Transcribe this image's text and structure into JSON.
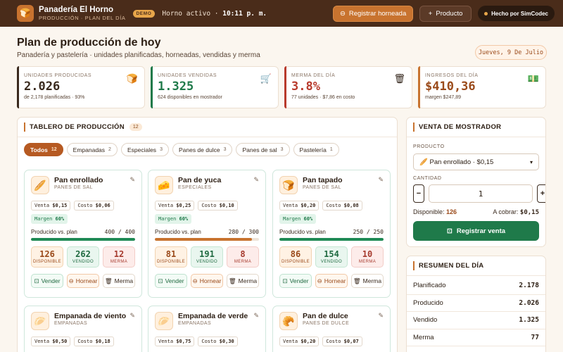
{
  "header": {
    "brand_name": "Panadería El Horno",
    "brand_sub": "PRODUCCIÓN · PLAN DEL DÍA",
    "demo_badge": "DEMO",
    "status_label": "Horno activo",
    "time": "10:11 p. m.",
    "register_batch_label": "Registrar horneada",
    "product_label": "Producto",
    "made_by": "Hecho por SimCodec"
  },
  "page": {
    "title": "Plan de producción de hoy",
    "subtitle": "Panadería y pastelería · unidades planificadas, horneadas, vendidas y merma",
    "date": "Jueves, 9 De Julio"
  },
  "kpis": [
    {
      "label": "UNIDADES PRODUCIDAS",
      "value": "2.026",
      "foot": "de 2,178 planificadas · 93%",
      "icon": "bread-icon",
      "color": "#3a2a1e"
    },
    {
      "label": "UNIDADES VENDIDAS",
      "value": "1.325",
      "foot": "624 disponibles en mostrador",
      "icon": "cart-icon",
      "color": "#1f7a4a"
    },
    {
      "label": "MERMA DEL DÍA",
      "value": "3.8%",
      "foot": "77 unidades · $7,86 en costo",
      "icon": "trash-icon",
      "color": "#b83a2c"
    },
    {
      "label": "INGRESOS DEL DÍA",
      "value": "$410,36",
      "foot": "margen $247,89",
      "icon": "money-icon",
      "color": "#9a4a1a"
    }
  ],
  "board": {
    "title": "TABLERO DE PRODUCCIÓN",
    "count": "12",
    "filters": [
      {
        "label": "Todos",
        "count": "12",
        "active": true
      },
      {
        "label": "Empanadas",
        "count": "2"
      },
      {
        "label": "Especiales",
        "count": "3"
      },
      {
        "label": "Panes de dulce",
        "count": "3"
      },
      {
        "label": "Panes de sal",
        "count": "3"
      },
      {
        "label": "Pastelería",
        "count": "1"
      }
    ],
    "labels": {
      "venta": "Venta",
      "costo": "Costo",
      "margen": "Margen",
      "progress": "Producido vs. plan",
      "disponible": "DISPONIBLE",
      "vendido": "VENDIDO",
      "merma": "MERMA",
      "sell": "Vender",
      "bake": "Hornear",
      "waste": "Merma"
    },
    "products": [
      {
        "name": "Pan enrollado",
        "category": "PANES DE SAL",
        "icon": "baguette-icon",
        "venta": "$0,15",
        "costo": "$0,06",
        "margen": "60%",
        "produced": 400,
        "plan": 400,
        "progress_label": "400 / 400",
        "disponible": "126",
        "vendido": "262",
        "merma": "12",
        "fill": "#1f8a55"
      },
      {
        "name": "Pan de yuca",
        "category": "ESPECIALES",
        "icon": "cheese-icon",
        "venta": "$0,25",
        "costo": "$0,10",
        "margen": "60%",
        "produced": 280,
        "plan": 300,
        "progress_label": "280 / 300",
        "disponible": "81",
        "vendido": "191",
        "merma": "8",
        "fill": "#c8732f"
      },
      {
        "name": "Pan tapado",
        "category": "PANES DE SAL",
        "icon": "toast-icon",
        "venta": "$0,20",
        "costo": "$0,08",
        "margen": "60%",
        "produced": 250,
        "plan": 250,
        "progress_label": "250 / 250",
        "disponible": "86",
        "vendido": "154",
        "merma": "10",
        "fill": "#1f8a55"
      },
      {
        "name": "Empanada de viento",
        "category": "EMPANADAS",
        "icon": "empanada-icon",
        "venta": "$0,50",
        "costo": "$0,18"
      },
      {
        "name": "Empanada de verde",
        "category": "EMPANADAS",
        "icon": "empanada-icon",
        "venta": "$0,75",
        "costo": "$0,30"
      },
      {
        "name": "Pan de dulce",
        "category": "PANES DE DULCE",
        "icon": "croissant-icon",
        "venta": "$0,20",
        "costo": "$0,07"
      }
    ]
  },
  "sale": {
    "title": "VENTA DE MOSTRADOR",
    "product_label": "PRODUCTO",
    "product_value": "Pan enrollado · $0,15",
    "qty_label": "CANTIDAD",
    "qty_value": "1",
    "minus": "−",
    "plus": "+",
    "available_label": "Disponible:",
    "available_value": "126",
    "charge_label": "A cobrar:",
    "charge_value": "$0,15",
    "submit_label": "Registrar venta"
  },
  "summary": {
    "title": "RESUMEN DEL DÍA",
    "rows": [
      {
        "label": "Planificado",
        "value": "2.178"
      },
      {
        "label": "Producido",
        "value": "2.026"
      },
      {
        "label": "Vendido",
        "value": "1.325"
      },
      {
        "label": "Merma",
        "value": "77"
      }
    ]
  },
  "colors": {
    "brand_dark": "#4a2c1a",
    "accent": "#c8732f",
    "green": "#1f7a4a",
    "red": "#b83a2c"
  }
}
